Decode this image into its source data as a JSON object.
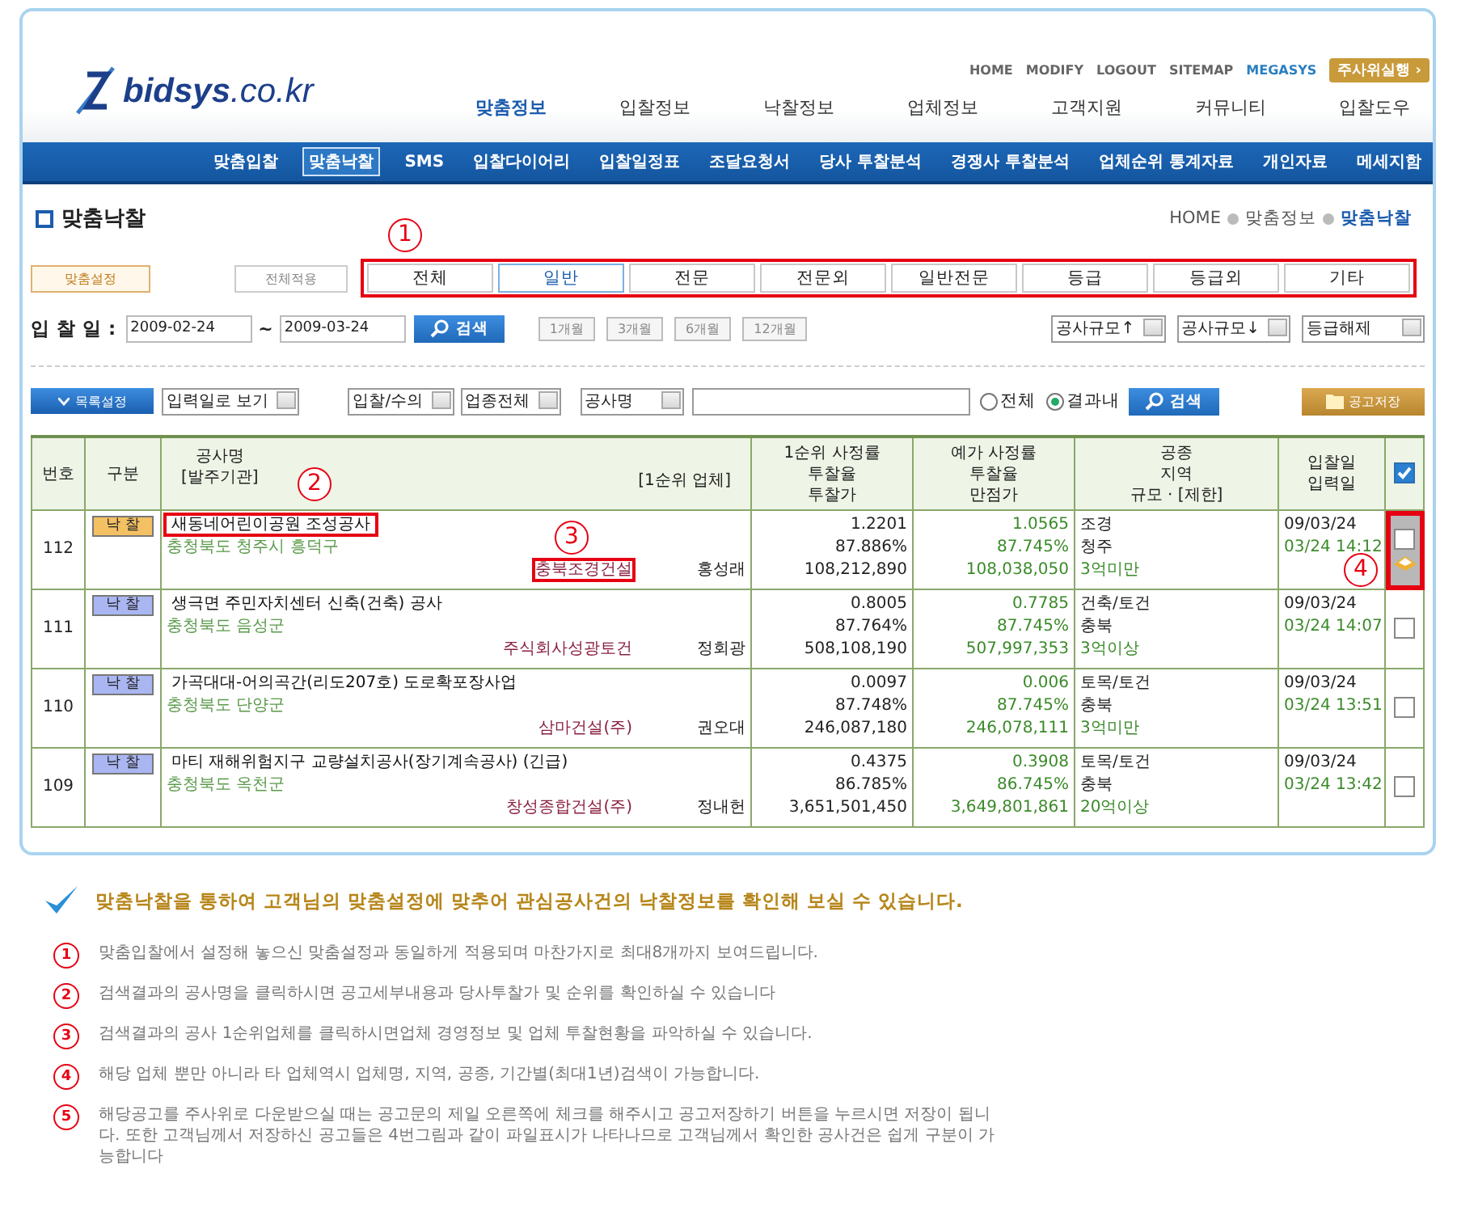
{
  "header": {
    "logo": "**bidsys**.co.kr",
    "top_links": [
      {
        "label": "HOME",
        "kind": "plain"
      },
      {
        "label": "MODIFY",
        "kind": "plain"
      },
      {
        "label": "LOGOUT",
        "kind": "plain"
      },
      {
        "label": "SITEMAP",
        "kind": "plain"
      },
      {
        "label": "MEGASYS",
        "kind": "brand"
      }
    ],
    "dice_button": "주사위실행 ›",
    "main_nav": [
      {
        "label": "맞춤정보",
        "selected": true
      },
      {
        "label": "입찰정보",
        "selected": false
      },
      {
        "label": "낙찰정보",
        "selected": false
      },
      {
        "label": "업체정보",
        "selected": false
      },
      {
        "label": "고객지원",
        "selected": false
      },
      {
        "label": "커뮤니티",
        "selected": false
      },
      {
        "label": "입찰도우",
        "selected": false
      }
    ],
    "sub_nav": [
      {
        "label": "맞춤입찰",
        "selected": false
      },
      {
        "label": "맞춤낙찰",
        "selected": true
      },
      {
        "label": "SMS",
        "selected": false
      },
      {
        "label": "입찰다이어리",
        "selected": false
      },
      {
        "label": "입찰일정표",
        "selected": false
      },
      {
        "label": "조달요청서",
        "selected": false
      },
      {
        "label": "당사 투찰분석",
        "selected": false
      },
      {
        "label": "경쟁사 투찰분석",
        "selected": false
      },
      {
        "label": "업체순위 통계자료",
        "selected": false
      },
      {
        "label": "개인자료",
        "selected": false
      },
      {
        "label": "메세지함",
        "selected": false
      }
    ]
  },
  "page": {
    "title": "맞춤낙찰",
    "breadcrumb": [
      {
        "label": "HOME",
        "current": false
      },
      {
        "label": "맞춤정보",
        "current": false
      },
      {
        "label": "맞춤낙찰",
        "current": true
      }
    ]
  },
  "settings": {
    "custom_button": "맞춤설정",
    "apply_all_button": "전체적용",
    "callout": "1",
    "tabs": [
      {
        "label": "전체",
        "selected": false
      },
      {
        "label": "일반",
        "selected": true
      },
      {
        "label": "전문",
        "selected": false
      },
      {
        "label": "전문외",
        "selected": false
      },
      {
        "label": "일반전문",
        "selected": false
      },
      {
        "label": "등급",
        "selected": false
      },
      {
        "label": "등급외",
        "selected": false
      },
      {
        "label": "기타",
        "selected": false
      }
    ]
  },
  "date_filter": {
    "label": "입 찰 일 :",
    "from": "2009-02-24",
    "separator": "~",
    "to": "2009-03-24",
    "search_button": "검색",
    "periods": [
      "1개월",
      "3개월",
      "6개월",
      "12개월"
    ],
    "selects": [
      "공사규모↑",
      "공사규모↓",
      "등급해제"
    ]
  },
  "list_filter": {
    "list_settings_button": "목록설정",
    "selects": [
      "입력일로 보기",
      "입찰/수의",
      "업종전체",
      "공사명"
    ],
    "radios": [
      {
        "label": "전체",
        "selected": false
      },
      {
        "label": "결과내",
        "selected": true
      }
    ],
    "search_button": "검색",
    "save_button": "공고저장"
  },
  "table": {
    "columns": [
      {
        "lines": [
          "번호"
        ]
      },
      {
        "lines": [
          "구분"
        ]
      },
      {
        "lines": [
          "공사명",
          "[발주기관]"
        ],
        "right": "[1순위 업체]",
        "callout": "2"
      },
      {
        "lines": [
          "1순위 사정률",
          "투찰율",
          "투찰가"
        ]
      },
      {
        "lines": [
          "예가 사정률",
          "투찰율",
          "만점가"
        ]
      },
      {
        "lines": [
          "공종",
          "지역",
          "규모 · [제한]"
        ]
      },
      {
        "lines": [
          "입찰일",
          "입력일"
        ]
      }
    ],
    "select_all_checked": true,
    "rows": [
      {
        "no": "112",
        "badge": "낙 찰",
        "color": "#f3c063",
        "name": "새동네어린이공원 조성공사",
        "name_highlight": true,
        "agency": "충청북도 청주시 흥덕구",
        "firm": "충북조경건설",
        "firm_highlight": true,
        "firm_callout": "3",
        "person": "홍성래",
        "rate1": "1.2201",
        "bid_rate1": "87.886%",
        "price1": "108,212,890",
        "rate2": "1.0565",
        "bid_rate2": "87.745%",
        "price2": "108,038,050",
        "type": "조경",
        "region": "청주",
        "scale": "3억미만",
        "bid_date": "09/03/24",
        "input_date": "03/24 14:12",
        "checked": false,
        "saved": true,
        "check_callout": "4"
      },
      {
        "no": "111",
        "badge": "낙 찰",
        "color": "#aab6f2",
        "name": "생극면 주민자치센터 신축(건축) 공사",
        "name_highlight": false,
        "agency": "충청북도 음성군",
        "firm": "주식회사성광토건",
        "firm_highlight": false,
        "person": "정회광",
        "rate1": "0.8005",
        "bid_rate1": "87.764%",
        "price1": "508,108,190",
        "rate2": "0.7785",
        "bid_rate2": "87.745%",
        "price2": "507,997,353",
        "type": "건축/토건",
        "region": "충북",
        "scale": "3억이상",
        "bid_date": "09/03/24",
        "input_date": "03/24 14:07",
        "checked": false,
        "saved": false
      },
      {
        "no": "110",
        "badge": "낙 찰",
        "color": "#aab6f2",
        "name": "가곡대대-어의곡간(리도207호) 도로확포장사업",
        "name_highlight": false,
        "agency": "충청북도 단양군",
        "firm": "삼마건설(주)",
        "firm_highlight": false,
        "person": "권오대",
        "rate1": "0.0097",
        "bid_rate1": "87.748%",
        "price1": "246,087,180",
        "rate2": "0.006",
        "bid_rate2": "87.745%",
        "price2": "246,078,111",
        "type": "토목/토건",
        "region": "충북",
        "scale": "3억미만",
        "bid_date": "09/03/24",
        "input_date": "03/24 13:51",
        "checked": false,
        "saved": false
      },
      {
        "no": "109",
        "badge": "낙 찰",
        "color": "#aab6f2",
        "name": "마티 재해위험지구 교량설치공사(장기계속공사) (긴급)",
        "name_highlight": false,
        "agency": "충청북도 옥천군",
        "firm": "창성종합건설(주)",
        "firm_highlight": false,
        "person": "정내헌",
        "rate1": "0.4375",
        "bid_rate1": "86.785%",
        "price1": "3,651,501,450",
        "rate2": "0.3908",
        "bid_rate2": "86.745%",
        "price2": "3,649,801,861",
        "type": "토목/토건",
        "region": "충북",
        "scale": "20억이상",
        "bid_date": "09/03/24",
        "input_date": "03/24 13:42",
        "checked": false,
        "saved": false
      }
    ]
  },
  "notes": {
    "headline": "맞춤낙찰을 통하여 고객님의 맞춤설정에 맞추어 관심공사건의 낙찰정보를 확인해 보실 수 있습니다.",
    "items": [
      {
        "num": "1",
        "text": "맞춤입찰에서 설정해 놓으신 맞춤설정과 동일하게 적용되며 마찬가지로 최대8개까지 보여드립니다."
      },
      {
        "num": "2",
        "text": "검색결과의 공사명을 클릭하시면 공고세부내용과 당사투찰가 및 순위를 확인하실 수 있습니다"
      },
      {
        "num": "3",
        "text": "검색결과의 공사 1순위업체를  클릭하시면업체 경영정보 및 업체 투찰현황을 파악하실 수 있습니다."
      },
      {
        "num": "4",
        "text": "해당 업체 뿐만 아니라 타 업체역시 업체명, 지역, 공종, 기간별(최대1년)검색이 가능합니다."
      },
      {
        "num": "5",
        "text": "해당공고를 주사위로 다운받으실 때는 공고문의 제일 오른쪽에 체크를 해주시고 공고저장하기 버튼을 누르시면 저장이 됩니다. 또한 고객님께서 저장하신 공고들은 4번그림과 같이 파일표시가 나타나므로 고객님께서 확인한 공사건은 쉽게 구분이 가능합니다"
      }
    ]
  }
}
